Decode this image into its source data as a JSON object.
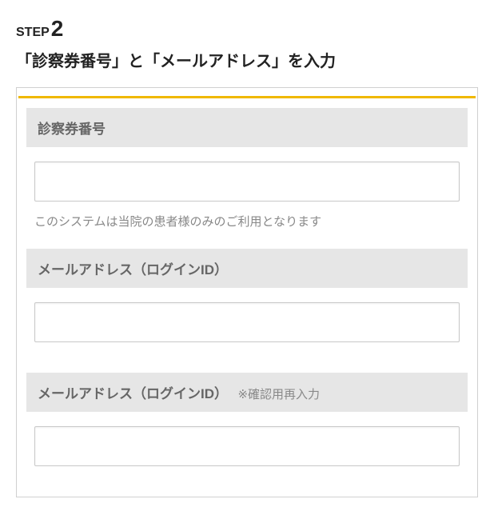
{
  "step": {
    "prefix": "STEP",
    "number": "2",
    "title": "「診察券番号」と「メールアドレス」を入力"
  },
  "form": {
    "sections": [
      {
        "label": "診察券番号",
        "note": "",
        "value": "",
        "hint": "このシステムは当院の患者様のみのご利用となります"
      },
      {
        "label": "メールアドレス（ログインID）",
        "note": "",
        "value": "",
        "hint": ""
      },
      {
        "label": "メールアドレス（ログインID）",
        "note": "※確認用再入力",
        "value": "",
        "hint": ""
      }
    ]
  }
}
